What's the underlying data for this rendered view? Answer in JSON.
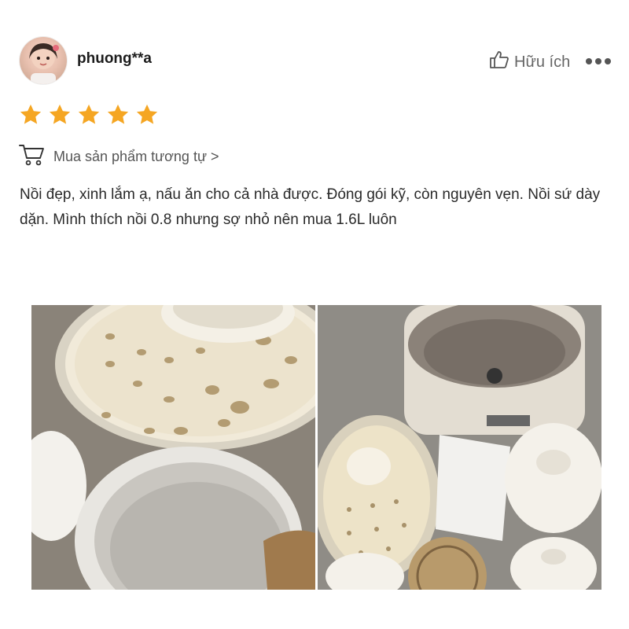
{
  "review": {
    "username": "phuong**a",
    "helpful_label": "Hữu ích",
    "rating": 5,
    "rating_max": 5,
    "similar_link": "Mua sản phẩm tương tự >",
    "text": "Nồi đẹp, xinh lắm ạ, nấu ăn cho cả nhà được. Đóng gói kỹ, còn nguyên vẹn. Nồi sứ dày dặn. Mình thích nồi 0.8 nhưng sợ nhỏ nên mua 1.6L luôn"
  },
  "icons": {
    "helpful": "thumbs-up-icon",
    "more": "more-dots-icon",
    "cart": "cart-icon",
    "star": "star-icon"
  },
  "colors": {
    "star": "#F5A623",
    "text": "#2a2a2a",
    "muted": "#666666"
  },
  "photos": [
    {
      "name": "photo-1"
    },
    {
      "name": "photo-2"
    }
  ]
}
